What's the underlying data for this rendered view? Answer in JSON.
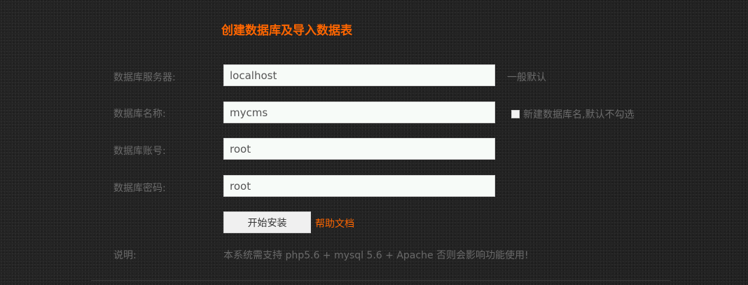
{
  "title": "创建数据库及导入数据表",
  "fields": [
    {
      "label": "数据库服务器:",
      "value": "localhost",
      "hint": "一般默认"
    },
    {
      "label": "数据库名称:",
      "value": "mycms",
      "checkbox_label": "新建数据库名,默认不勾选",
      "checkbox_checked": false
    },
    {
      "label": "数据库账号:",
      "value": "root"
    },
    {
      "label": "数据库密码:",
      "value": "root"
    }
  ],
  "actions": {
    "install_label": "开始安装",
    "help_label": "帮助文档"
  },
  "note": {
    "label": "说明:",
    "text": "本系统需支持 php5.6 + mysql 5.6 + Apache 否则会影响功能使用!"
  },
  "colors": {
    "accent": "#ff6600",
    "background": "#232323",
    "input_bg": "#f7fbf8"
  }
}
